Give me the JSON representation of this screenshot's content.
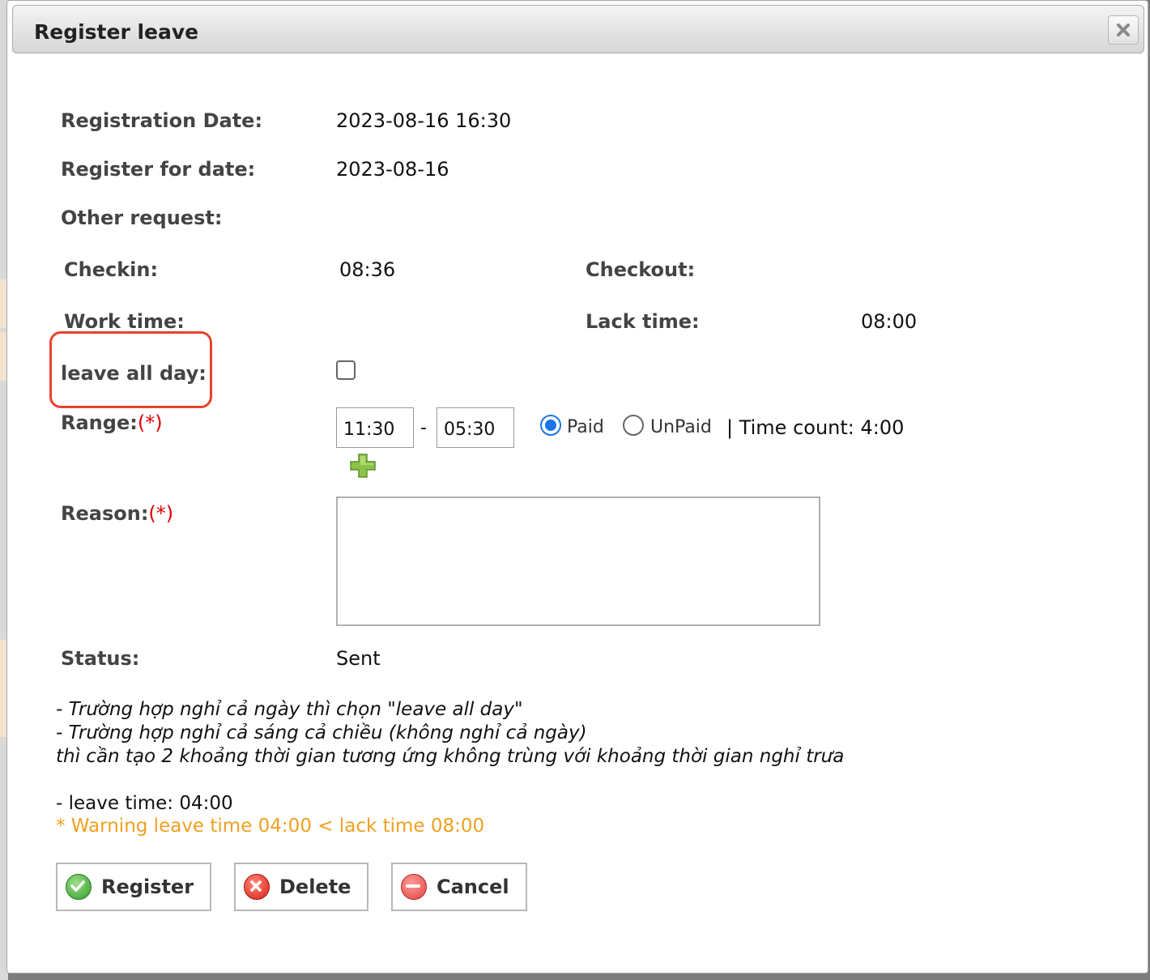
{
  "dialog": {
    "title": "Register leave",
    "close_icon": "close-icon"
  },
  "fields": {
    "registration_date_label": "Registration Date:",
    "registration_date_value": "2023-08-16 16:30",
    "register_for_date_label": "Register for date:",
    "register_for_date_value": "2023-08-16",
    "other_request_label": "Other request:",
    "checkin_label": "Checkin:",
    "checkin_value": "08:36",
    "checkout_label": "Checkout:",
    "work_time_label": "Work time:",
    "lack_time_label": "Lack time:",
    "lack_time_value": "08:00",
    "leave_all_day_label": "leave all day:",
    "leave_all_day_checked": false,
    "range_label": "Range:",
    "required_marker": "(*)",
    "range_start": "11:30",
    "range_separator": "-",
    "range_end": "05:30",
    "paid_label": "Paid",
    "unpaid_label": "UnPaid",
    "selected_pay_type": "Paid",
    "time_count_text": "| Time count: 4:00",
    "reason_label": "Reason:",
    "reason_value": "",
    "status_label": "Status:",
    "status_value": "Sent"
  },
  "notes": {
    "line1": "- Trường hợp nghỉ cả ngày thì chọn \"leave all day\"",
    "line2": "- Trường hợp nghỉ cả sáng cả chiều (không nghỉ cả ngày)",
    "line3": "thì cần tạo 2 khoảng thời gian tương ứng không trùng với khoảng thời gian nghỉ trưa",
    "leave_time": "- leave time: 04:00",
    "warning": "* Warning leave time 04:00 < lack time 08:00"
  },
  "buttons": {
    "register": "Register",
    "delete": "Delete",
    "cancel": "Cancel"
  },
  "colors": {
    "required": "#e00000",
    "warning": "#f0a020",
    "highlight": "#e8432c",
    "radio_accent": "#1a73e8"
  }
}
